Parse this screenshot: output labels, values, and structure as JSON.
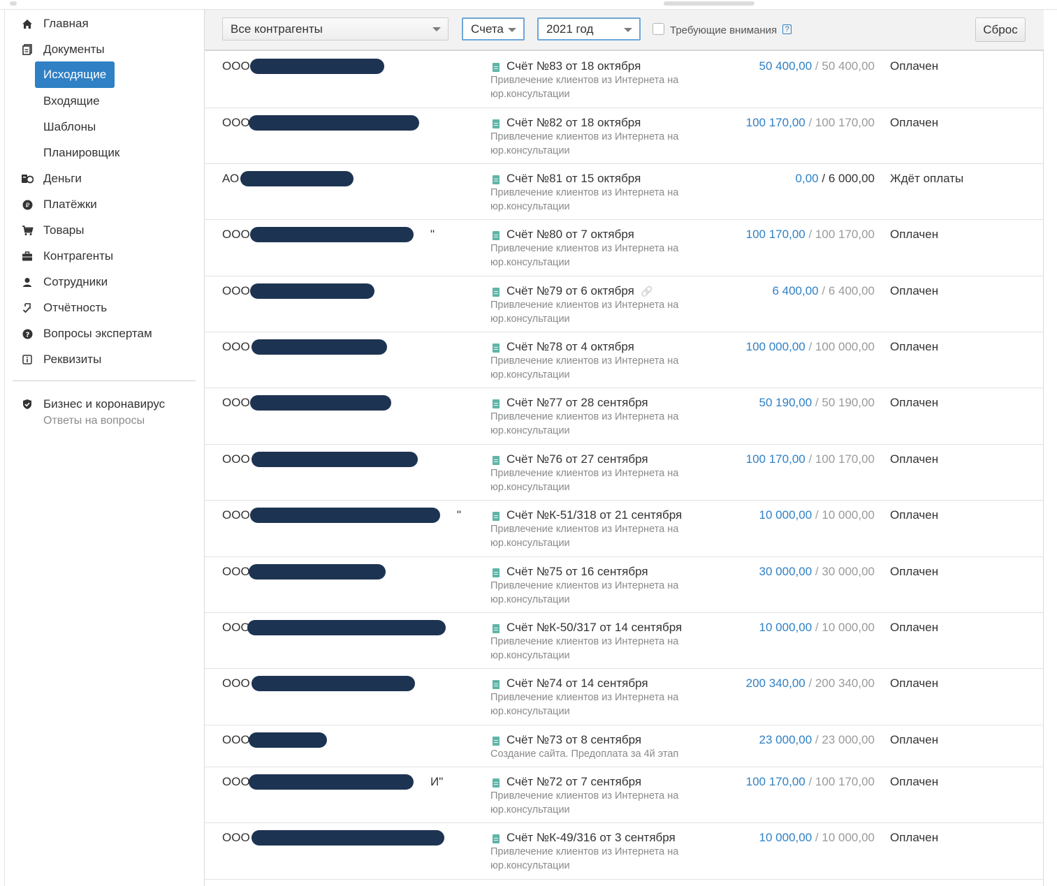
{
  "sidebar": {
    "nav": [
      {
        "label": "Главная",
        "icon": "home-icon"
      },
      {
        "label": "Документы",
        "icon": "documents-icon"
      },
      {
        "label": "Деньги",
        "icon": "money-icon"
      },
      {
        "label": "Платёжки",
        "icon": "payment-icon"
      },
      {
        "label": "Товары",
        "icon": "cart-icon"
      },
      {
        "label": "Контрагенты",
        "icon": "briefcase-icon"
      },
      {
        "label": "Сотрудники",
        "icon": "person-icon"
      },
      {
        "label": "Отчётность",
        "icon": "report-icon"
      },
      {
        "label": "Вопросы экспертам",
        "icon": "question-icon"
      },
      {
        "label": "Реквизиты",
        "icon": "info-icon"
      }
    ],
    "documents_sub": [
      {
        "label": "Исходящие",
        "active": true
      },
      {
        "label": "Входящие",
        "active": false
      },
      {
        "label": "Шаблоны",
        "active": false
      },
      {
        "label": "Планировщик",
        "active": false
      }
    ],
    "promo": {
      "title": "Бизнес и коронавирус",
      "subtitle": "Ответы на вопросы",
      "icon": "shield-icon"
    }
  },
  "filters": {
    "counterparty": "Все контрагенты",
    "doc_type": "Счета",
    "year": "2021 год",
    "attention_label": "Требующие внимания",
    "attention_checked": false,
    "help": "?",
    "reset_label": "Сброс"
  },
  "invoices": [
    {
      "cp_prefix": "ООО",
      "cp_suffix": "",
      "title": "Счёт №83 от 18 октября",
      "desc": "Привлечение клиентов из Интернета на юр.консультации",
      "paid": "50 400,00",
      "total": "50 400,00",
      "status": "Оплачен",
      "linked": false
    },
    {
      "cp_prefix": "ООО",
      "cp_suffix": "",
      "title": "Счёт №82 от 18 октября",
      "desc": "Привлечение клиентов из Интернета на юр.консультации",
      "paid": "100 170,00",
      "total": "100 170,00",
      "status": "Оплачен",
      "linked": false
    },
    {
      "cp_prefix": "АО",
      "cp_suffix": "",
      "title": "Счёт №81 от 15 октября",
      "desc": "Привлечение клиентов из Интернета на юр.консультации",
      "paid": "0,00",
      "total": "6 000,00",
      "status": "Ждёт оплаты",
      "linked": false
    },
    {
      "cp_prefix": "ООО",
      "cp_suffix": "\"",
      "title": "Счёт №80 от 7 октября",
      "desc": "Привлечение клиентов из Интернета на юр.консультации",
      "paid": "100 170,00",
      "total": "100 170,00",
      "status": "Оплачен",
      "linked": false
    },
    {
      "cp_prefix": "ООО",
      "cp_suffix": "",
      "title": "Счёт №79 от 6 октября",
      "desc": "Привлечение клиентов из Интернета на юр.консультации",
      "paid": "6 400,00",
      "total": "6 400,00",
      "status": "Оплачен",
      "linked": true
    },
    {
      "cp_prefix": "ООО",
      "cp_suffix": "",
      "title": "Счёт №78 от 4 октября",
      "desc": "Привлечение клиентов из Интернета на юр.консультации",
      "paid": "100 000,00",
      "total": "100 000,00",
      "status": "Оплачен",
      "linked": false
    },
    {
      "cp_prefix": "ООО",
      "cp_suffix": "",
      "title": "Счёт №77 от 28 сентября",
      "desc": "Привлечение клиентов из Интернета на юр.консультации",
      "paid": "50 190,00",
      "total": "50 190,00",
      "status": "Оплачен",
      "linked": false
    },
    {
      "cp_prefix": "ООО",
      "cp_suffix": "",
      "title": "Счёт №76 от 27 сентября",
      "desc": "Привлечение клиентов из Интернета на юр.консультации",
      "paid": "100 170,00",
      "total": "100 170,00",
      "status": "Оплачен",
      "linked": false
    },
    {
      "cp_prefix": "ООО",
      "cp_suffix": "\"",
      "title": "Счёт №К-51/318 от 21 сентября",
      "desc": "Привлечение клиентов из Интернета на юр.консультации",
      "paid": "10 000,00",
      "total": "10 000,00",
      "status": "Оплачен",
      "linked": false
    },
    {
      "cp_prefix": "ООО",
      "cp_suffix": "",
      "title": "Счёт №75 от 16 сентября",
      "desc": "Привлечение клиентов из Интернета на юр.консультации",
      "paid": "30 000,00",
      "total": "30 000,00",
      "status": "Оплачен",
      "linked": false
    },
    {
      "cp_prefix": "ООО",
      "cp_suffix": "",
      "title": "Счёт №К-50/317 от 14 сентября",
      "desc": "Привлечение клиентов из Интернета на юр.консультации",
      "paid": "10 000,00",
      "total": "10 000,00",
      "status": "Оплачен",
      "linked": false
    },
    {
      "cp_prefix": "ООО",
      "cp_suffix": "",
      "title": "Счёт №74 от 14 сентября",
      "desc": "Привлечение клиентов из Интернета на юр.консультации",
      "paid": "200 340,00",
      "total": "200 340,00",
      "status": "Оплачен",
      "linked": false
    },
    {
      "cp_prefix": "ООО",
      "cp_suffix": "",
      "title": "Счёт №73 от 8 сентября",
      "desc": "Создание сайта. Предоплата за 4й этап",
      "paid": "23 000,00",
      "total": "23 000,00",
      "status": "Оплачен",
      "linked": false
    },
    {
      "cp_prefix": "ООО",
      "cp_suffix": "И\"",
      "title": "Счёт №72 от 7 сентября",
      "desc": "Привлечение клиентов из Интернета на юр.консультации",
      "paid": "100 170,00",
      "total": "100 170,00",
      "status": "Оплачен",
      "linked": false
    },
    {
      "cp_prefix": "ООО",
      "cp_suffix": "",
      "title": "Счёт №К-49/316 от 3 сентября",
      "desc": "Привлечение клиентов из Интернета на юр.консультации",
      "paid": "10 000,00",
      "total": "10 000,00",
      "status": "Оплачен",
      "linked": false
    }
  ],
  "colors": {
    "accent": "#2f80c5",
    "redaction": "#1d3352",
    "doc_icon": "#5fb5a8"
  }
}
